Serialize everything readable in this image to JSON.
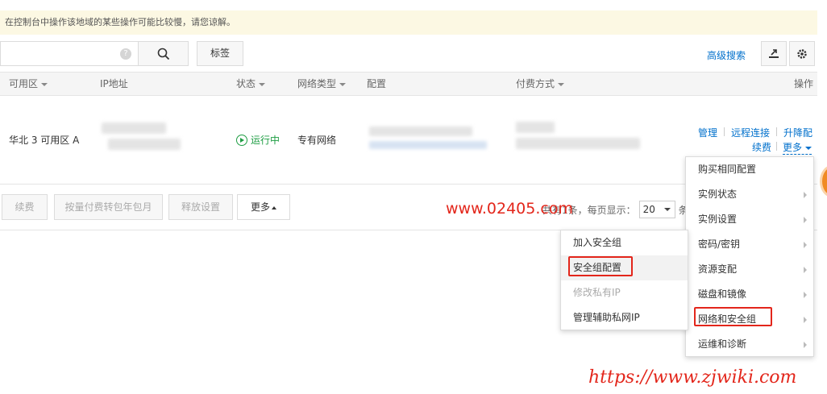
{
  "notice": "在控制台中操作该地域的某些操作可能比较慢，请您谅解。",
  "toolbar": {
    "search_placeholder": "",
    "tag_label": "标签",
    "advanced_search": "高级搜索"
  },
  "table": {
    "headers": {
      "zone": "可用区",
      "ip": "IP地址",
      "status": "状态",
      "network": "网络类型",
      "config": "配置",
      "billing": "付费方式",
      "actions": "操作"
    },
    "row": {
      "zone": "华北 3 可用区 A",
      "status": "运行中",
      "network": "专有网络",
      "actions": {
        "manage": "管理",
        "remote": "远程连接",
        "upgrade": "升降配",
        "renew": "续费",
        "more": "更多"
      }
    }
  },
  "bottom": {
    "buttons": [
      "续费",
      "按量付费转包年包月",
      "释放设置",
      "更多"
    ],
    "pager_total": "共有1条，",
    "pager_per_page": "每页显示：",
    "page_size": "20",
    "pager_unit": "条"
  },
  "more_menu": {
    "items": [
      "购买相同配置",
      "实例状态",
      "实例设置",
      "密码/密钥",
      "资源变配",
      "磁盘和镜像",
      "网络和安全组",
      "运维和诊断"
    ]
  },
  "sub_menu": {
    "items": [
      "加入安全组",
      "安全组配置",
      "修改私有IP",
      "管理辅助私网IP"
    ]
  },
  "watermarks": {
    "w1": "www.02405.com",
    "w2": "https://www.zjwiki.com"
  },
  "colors": {
    "link": "#0070cc",
    "running": "#1e9d43",
    "highlight": "#e3261b",
    "notice_bg": "#fcf8e3"
  }
}
